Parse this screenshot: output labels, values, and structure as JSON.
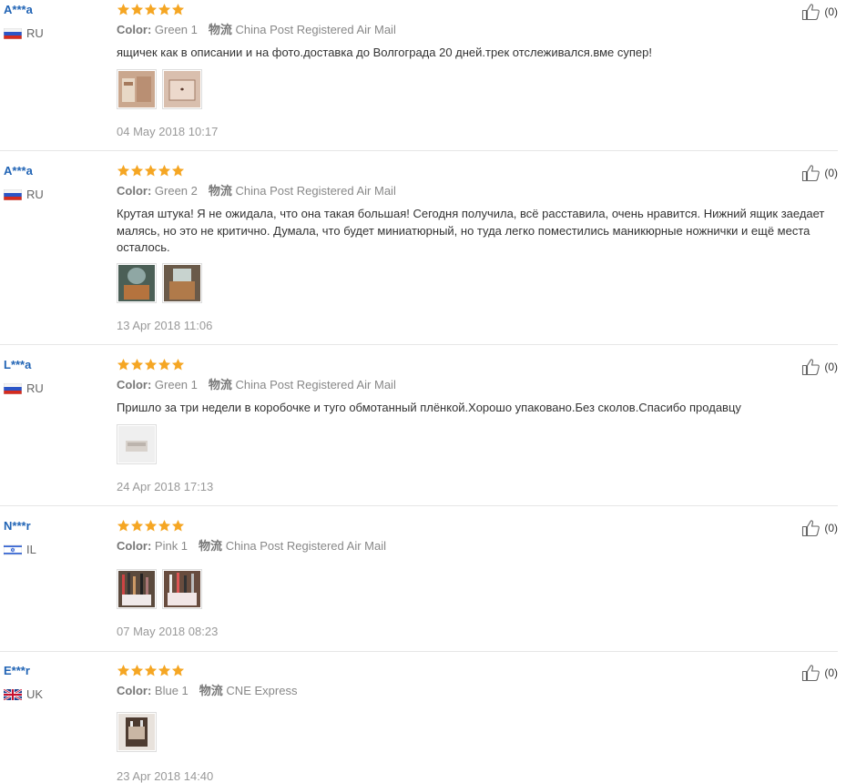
{
  "labels": {
    "color": "Color:",
    "shipping": "物流"
  },
  "colors": {
    "username": "#2164b5",
    "star": "#f5a623",
    "meta": "#888888",
    "date": "#999999"
  },
  "reviews": [
    {
      "user": "A***a",
      "country": "RU",
      "flag": "russia-flag-icon",
      "stars": 5,
      "color": "Green 1",
      "shipping": "China Post Registered Air Mail",
      "text": "ящичек как в описании и на фото.доставка до Волгограда 20 дней.трек отслеживался.вме супер!",
      "photos": 2,
      "date": "04 May 2018 10:17",
      "helpful": "(0)"
    },
    {
      "user": "A***a",
      "country": "RU",
      "flag": "russia-flag-icon",
      "stars": 5,
      "color": "Green 2",
      "shipping": "China Post Registered Air Mail",
      "text": "Крутая штука! Я не ожидала, что она такая большая! Сегодня получила, всё расставила, очень нравится. Нижний ящик заедает маляcь, но это не критично. Думала, что будет миниатюрный, но туда легко поместились маникюрные ножнички и ещё места осталось.",
      "photos": 2,
      "date": "13 Apr 2018 11:06",
      "helpful": "(0)"
    },
    {
      "user": "L***a",
      "country": "RU",
      "flag": "russia-flag-icon",
      "stars": 5,
      "color": "Green 1",
      "shipping": "China Post Registered Air Mail",
      "text": "Пришло за три недели в коробочке и туго обмотанный плёнкой.Хорошо упаковано.Без сколов.Спасибо продавцу",
      "photos": 1,
      "date": "24 Apr 2018 17:13",
      "helpful": "(0)"
    },
    {
      "user": "N***r",
      "country": "IL",
      "flag": "israel-flag-icon",
      "stars": 5,
      "color": "Pink 1",
      "shipping": "China Post Registered Air Mail",
      "text": "",
      "photos": 2,
      "date": "07 May 2018 08:23",
      "helpful": "(0)"
    },
    {
      "user": "E***r",
      "country": "UK",
      "flag": "uk-flag-icon",
      "stars": 5,
      "color": "Blue 1",
      "shipping": "CNE Express",
      "text": "",
      "photos": 1,
      "date": "23 Apr 2018 14:40",
      "helpful": "(0)"
    }
  ]
}
